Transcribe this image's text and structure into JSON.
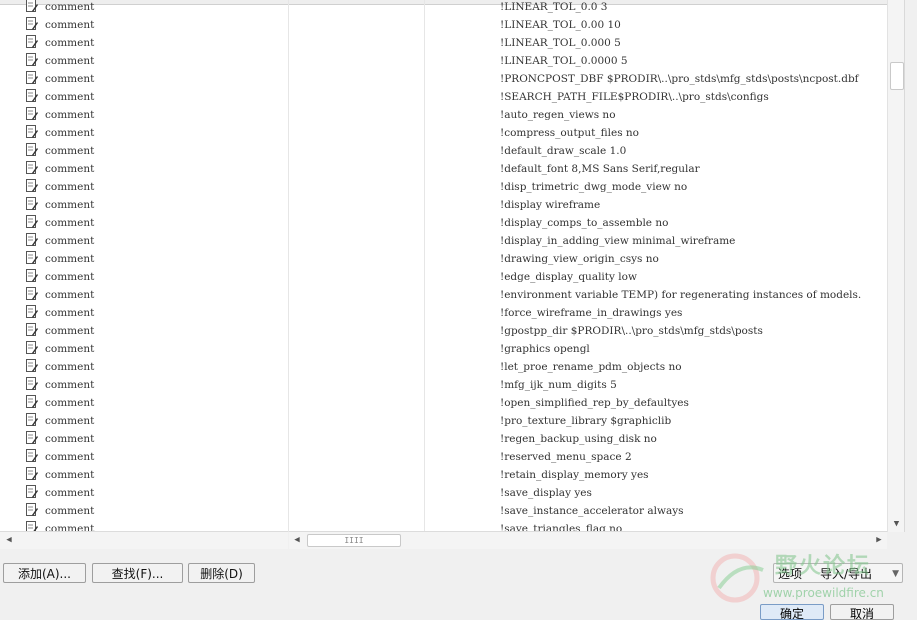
{
  "rows": [
    {
      "type": "comment",
      "value": "!LINEAR_TOL_0.0 3"
    },
    {
      "type": "comment",
      "value": "!LINEAR_TOL_0.00 10"
    },
    {
      "type": "comment",
      "value": "!LINEAR_TOL_0.000 5"
    },
    {
      "type": "comment",
      "value": "!LINEAR_TOL_0.0000 5"
    },
    {
      "type": "comment",
      "value": "!PRONCPOST_DBF $PRODIR\\..\\pro_stds\\mfg_stds\\posts\\ncpost.dbf"
    },
    {
      "type": "comment",
      "value": "!SEARCH_PATH_FILE$PRODIR\\..\\pro_stds\\configs"
    },
    {
      "type": "comment",
      "value": "!auto_regen_views no"
    },
    {
      "type": "comment",
      "value": "!compress_output_files no"
    },
    {
      "type": "comment",
      "value": "!default_draw_scale 1.0"
    },
    {
      "type": "comment",
      "value": "!default_font 8,MS Sans Serif,regular"
    },
    {
      "type": "comment",
      "value": "!disp_trimetric_dwg_mode_view no"
    },
    {
      "type": "comment",
      "value": "!display wireframe"
    },
    {
      "type": "comment",
      "value": "!display_comps_to_assemble no"
    },
    {
      "type": "comment",
      "value": "!display_in_adding_view minimal_wireframe"
    },
    {
      "type": "comment",
      "value": "!drawing_view_origin_csys no"
    },
    {
      "type": "comment",
      "value": "!edge_display_quality low"
    },
    {
      "type": "comment",
      "value": "!environment variable TEMP) for regenerating instances of models."
    },
    {
      "type": "comment",
      "value": "!force_wireframe_in_drawings yes"
    },
    {
      "type": "comment",
      "value": "!gpostpp_dir $PRODIR\\..\\pro_stds\\mfg_stds\\posts"
    },
    {
      "type": "comment",
      "value": "!graphics opengl"
    },
    {
      "type": "comment",
      "value": "!let_proe_rename_pdm_objects no"
    },
    {
      "type": "comment",
      "value": "!mfg_ijk_num_digits 5"
    },
    {
      "type": "comment",
      "value": "!open_simplified_rep_by_defaultyes"
    },
    {
      "type": "comment",
      "value": "!pro_texture_library $graphiclib"
    },
    {
      "type": "comment",
      "value": "!regen_backup_using_disk no"
    },
    {
      "type": "comment",
      "value": "!reserved_menu_space 2"
    },
    {
      "type": "comment",
      "value": "!retain_display_memory yes"
    },
    {
      "type": "comment",
      "value": "!save_display yes"
    },
    {
      "type": "comment",
      "value": "!save_instance_accelerator always"
    },
    {
      "type": "comment",
      "value": "!save_triangles_flag no"
    }
  ],
  "hscroll_grip": "IIII",
  "buttons": {
    "add": "添加(A)...",
    "find": "查找(F)...",
    "delete": "删除(D)",
    "options": "选项",
    "import_export": "导入/导出",
    "ok": "确定",
    "cancel": "取消"
  },
  "watermark": {
    "title": "野火论坛",
    "url": "www.proewildfire.cn"
  },
  "colors": {
    "row_text": "#333333",
    "watermark_green": "#7fc48a"
  },
  "icons": {
    "row_icon": "document-pencil-icon",
    "scroll_up": "chevron-up-icon",
    "scroll_down": "chevron-down-icon",
    "scroll_left": "chevron-left-icon",
    "scroll_right": "chevron-right-icon"
  }
}
